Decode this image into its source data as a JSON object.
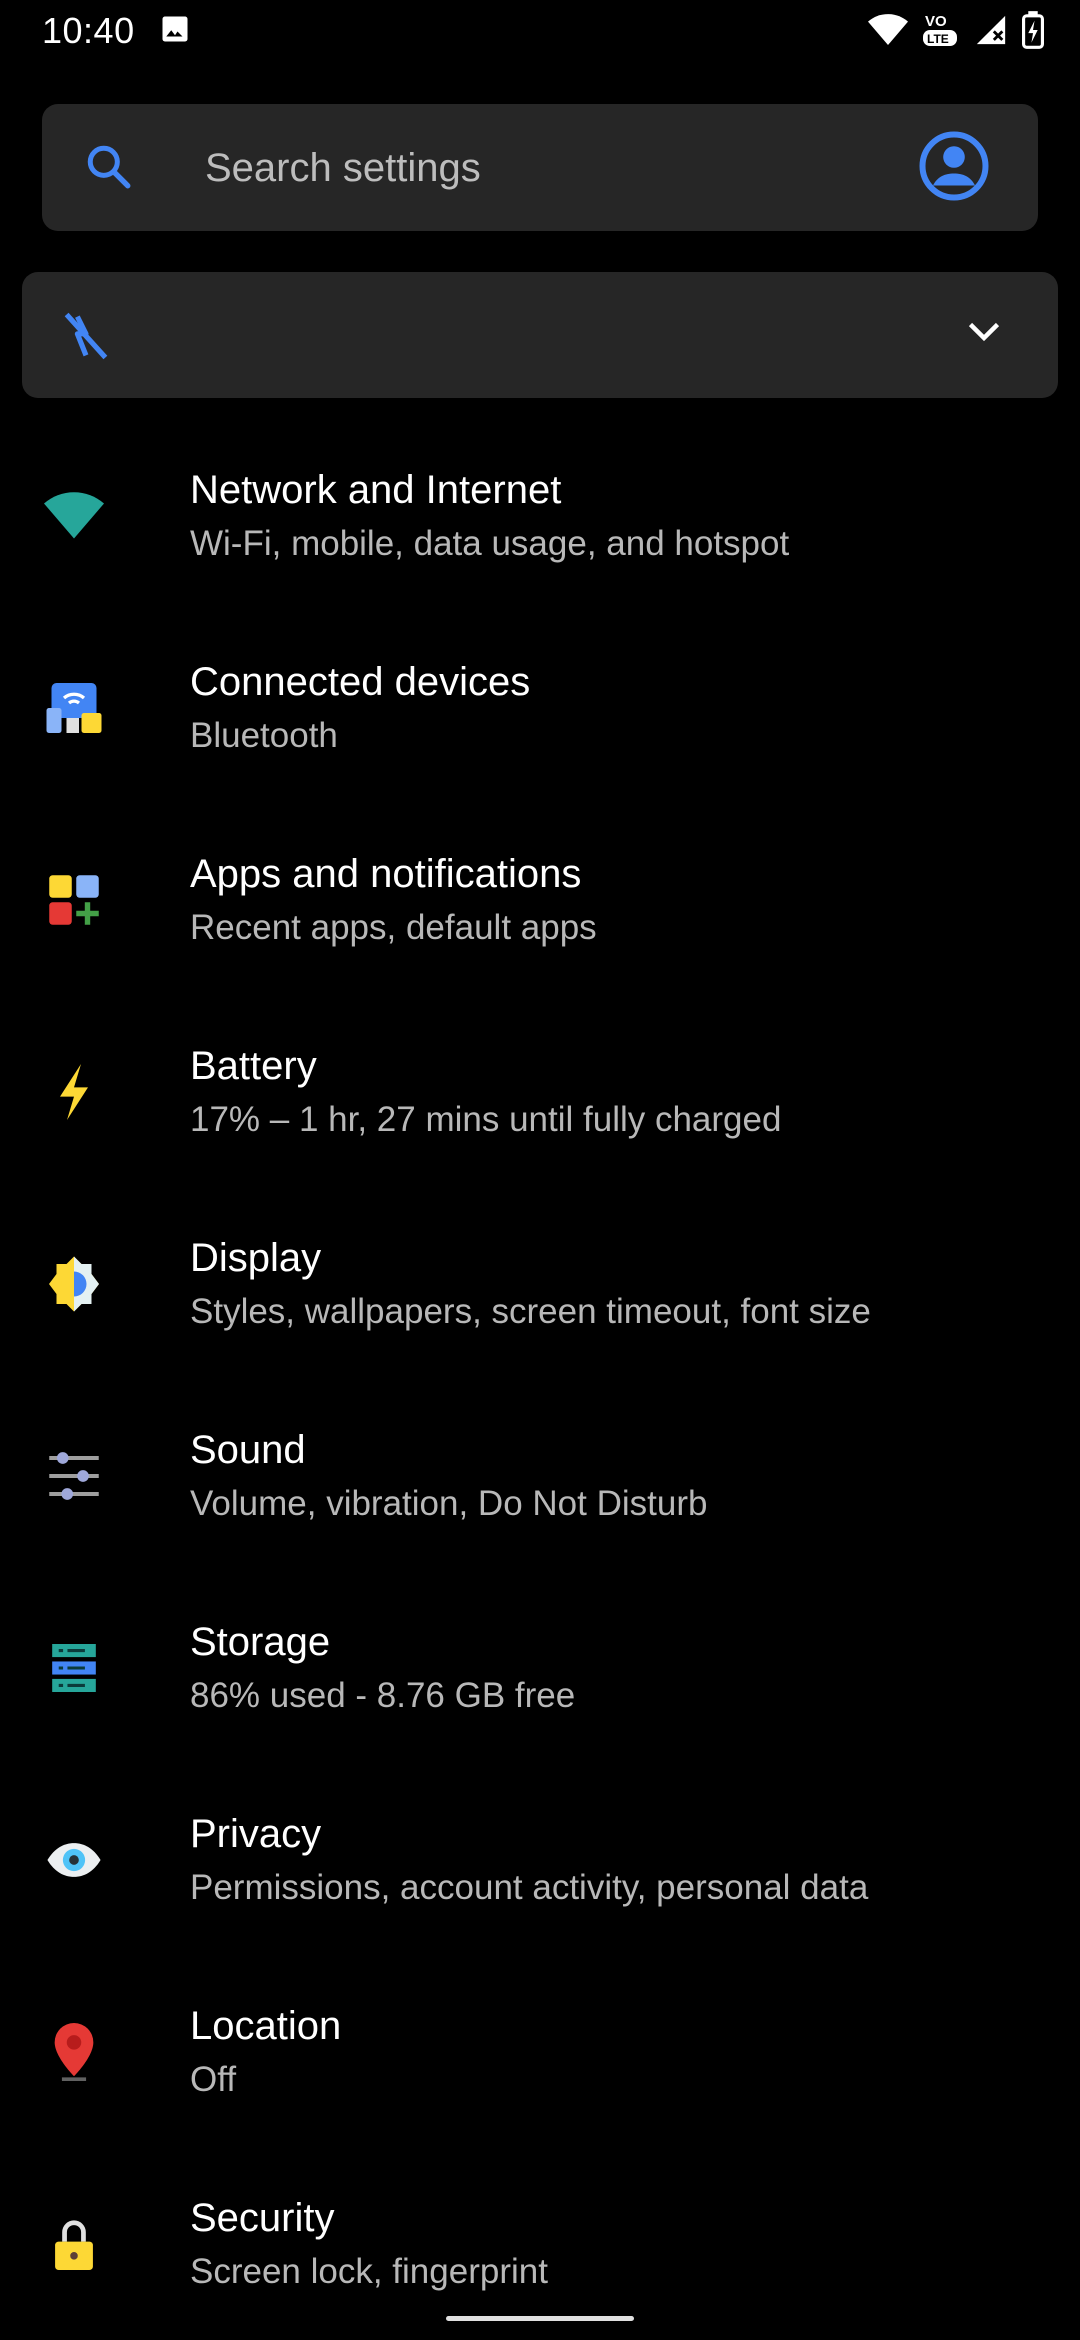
{
  "status_bar": {
    "time": "10:40",
    "icons": [
      "gallery-icon",
      "wifi-icon",
      "volte-icon",
      "signal-icon",
      "battery-charging-icon"
    ]
  },
  "search": {
    "placeholder": "Search settings"
  },
  "settings": [
    {
      "title": "Network and Internet",
      "subtitle": "Wi-Fi, mobile, data usage, and hotspot",
      "icon": "wifi-icon",
      "color": "#26a69a"
    },
    {
      "title": "Connected devices",
      "subtitle": "Bluetooth",
      "icon": "devices-icon",
      "color": "#4285f4"
    },
    {
      "title": "Apps and notifications",
      "subtitle": "Recent apps, default apps",
      "icon": "apps-icon",
      "color": "#fdd835"
    },
    {
      "title": "Battery",
      "subtitle": "17% – 1 hr, 27 mins until fully charged",
      "icon": "battery-bolt-icon",
      "color": "#fdd835"
    },
    {
      "title": "Display",
      "subtitle": "Styles, wallpapers, screen timeout, font size",
      "icon": "brightness-icon",
      "color": "#fdd835"
    },
    {
      "title": "Sound",
      "subtitle": "Volume, vibration, Do Not Disturb",
      "icon": "sliders-icon",
      "color": "#9fa8da"
    },
    {
      "title": "Storage",
      "subtitle": "86% used - 8.76 GB free",
      "icon": "storage-icon",
      "color": "#26a69a"
    },
    {
      "title": "Privacy",
      "subtitle": "Permissions, account activity, personal data",
      "icon": "eye-icon",
      "color": "#4fc3f7"
    },
    {
      "title": "Location",
      "subtitle": "Off",
      "icon": "location-pin-icon",
      "color": "#e53935"
    },
    {
      "title": "Security",
      "subtitle": "Screen lock, fingerprint",
      "icon": "lock-icon",
      "color": "#fdd835"
    }
  ],
  "colors": {
    "accent": "#4285f4",
    "card": "#262626",
    "background": "#000000"
  }
}
